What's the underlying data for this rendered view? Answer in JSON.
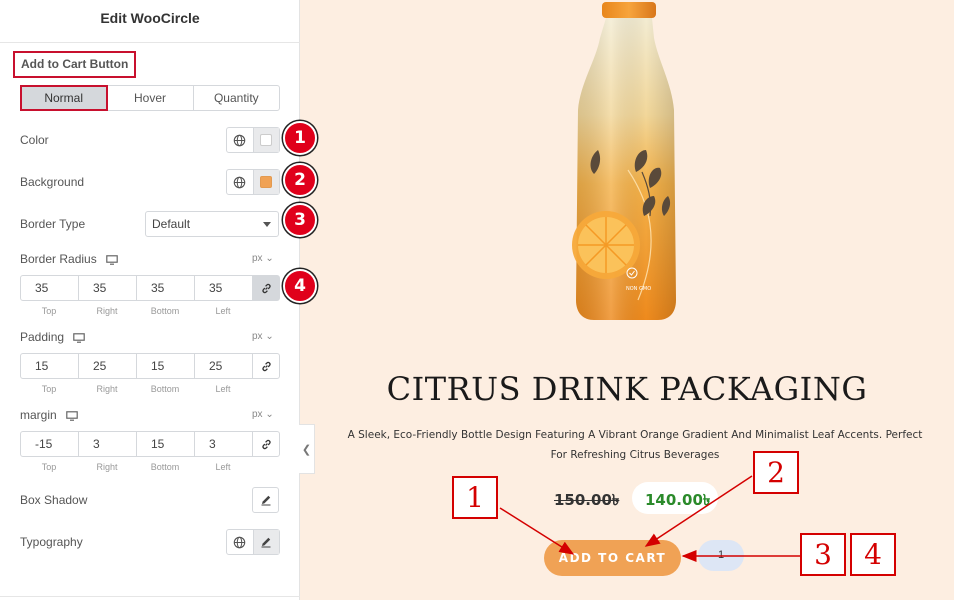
{
  "panel": {
    "title": "Edit WooCircle",
    "section_heading": "Add to Cart Button",
    "tabs": [
      {
        "label": "Normal",
        "active": true
      },
      {
        "label": "Hover",
        "active": false
      },
      {
        "label": "Quantity",
        "active": false
      }
    ],
    "color": {
      "label": "Color",
      "value": "#ffffff",
      "badge": "1"
    },
    "background": {
      "label": "Background",
      "value": "#f0a255",
      "badge": "2"
    },
    "border_type": {
      "label": "Border Type",
      "value": "Default",
      "badge": "3"
    },
    "border_radius": {
      "label": "Border Radius",
      "unit": "px",
      "badge": "4",
      "values": [
        "35",
        "35",
        "35",
        "35"
      ]
    },
    "padding": {
      "label": "Padding",
      "unit": "px",
      "values": [
        "15",
        "25",
        "15",
        "25"
      ]
    },
    "margin": {
      "label": "margin",
      "unit": "px",
      "values": [
        "-15",
        "3",
        "15",
        "3"
      ]
    },
    "dim_captions": [
      "Top",
      "Right",
      "Bottom",
      "Left"
    ],
    "box_shadow": {
      "label": "Box Shadow"
    },
    "typography": {
      "label": "Typography"
    }
  },
  "preview": {
    "product_title": "CITRUS DRINK PACKAGING",
    "description": "A Sleek, Eco-Friendly Bottle Design Featuring A Vibrant Orange Gradient And Minimalist Leaf Accents. Perfect For Refreshing Citrus Beverages",
    "old_price": "150.00৳",
    "new_price": "140.00৳",
    "add_to_cart_label": "ADD TO CART",
    "quantity": "1",
    "callouts": [
      "1",
      "2",
      "3",
      "4"
    ],
    "bottle_texts": [
      "NON GMO"
    ]
  },
  "colors": {
    "accent_red": "#d40000",
    "button_bg": "#f0a255",
    "preview_bg": "#fdeee1",
    "price_green": "#2a8a2a"
  },
  "icons": [
    "globe-icon",
    "monitor-icon",
    "link-icon",
    "pencil-icon",
    "chevron-left-icon",
    "caret-down-icon"
  ]
}
